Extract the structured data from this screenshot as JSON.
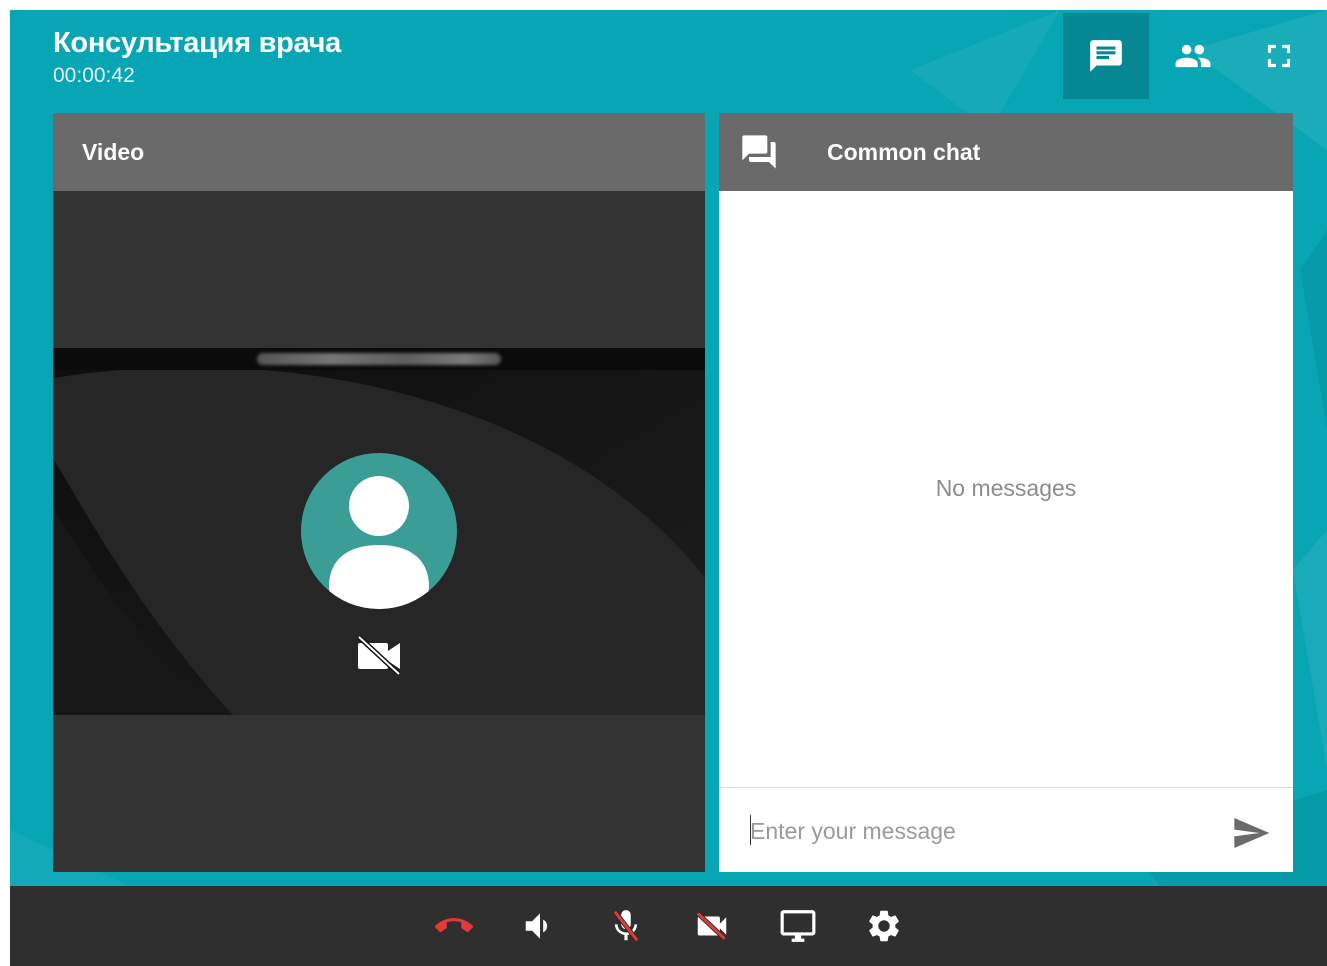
{
  "header": {
    "title": "Консультация врача",
    "timer": "00:00:42",
    "buttons": [
      {
        "name": "chat-toggle-button",
        "icon": "chat-icon",
        "active": true
      },
      {
        "name": "participants-button",
        "icon": "people-icon",
        "active": false
      },
      {
        "name": "fullscreen-button",
        "icon": "fullscreen-icon",
        "active": false
      }
    ]
  },
  "video": {
    "title": "Video",
    "participant": {
      "avatar_icon": "person-icon",
      "status_icon": "videocam-off-icon"
    }
  },
  "chat": {
    "title": "Common chat",
    "header_icon": "forum-icon",
    "empty_text": "No messages",
    "input_placeholder": "Enter your message",
    "send_icon": "send-icon"
  },
  "toolbar": {
    "buttons": [
      {
        "name": "hang-up-button",
        "icon": "call-end-icon",
        "color": "#e53935"
      },
      {
        "name": "volume-button",
        "icon": "volume-icon"
      },
      {
        "name": "microphone-button",
        "icon": "mic-off-icon",
        "strike_color": "#e53935"
      },
      {
        "name": "camera-button",
        "icon": "videocam-off-icon",
        "strike_color": "#e53935"
      },
      {
        "name": "screen-share-button",
        "icon": "monitor-icon"
      },
      {
        "name": "settings-button",
        "icon": "gear-icon"
      }
    ]
  },
  "colors": {
    "brand_teal": "#08a5b5",
    "panel_header": "#6a6a6a",
    "avatar_bg": "#3a9e97",
    "toolbar_bg": "#2f2f2f",
    "danger": "#e53935"
  }
}
